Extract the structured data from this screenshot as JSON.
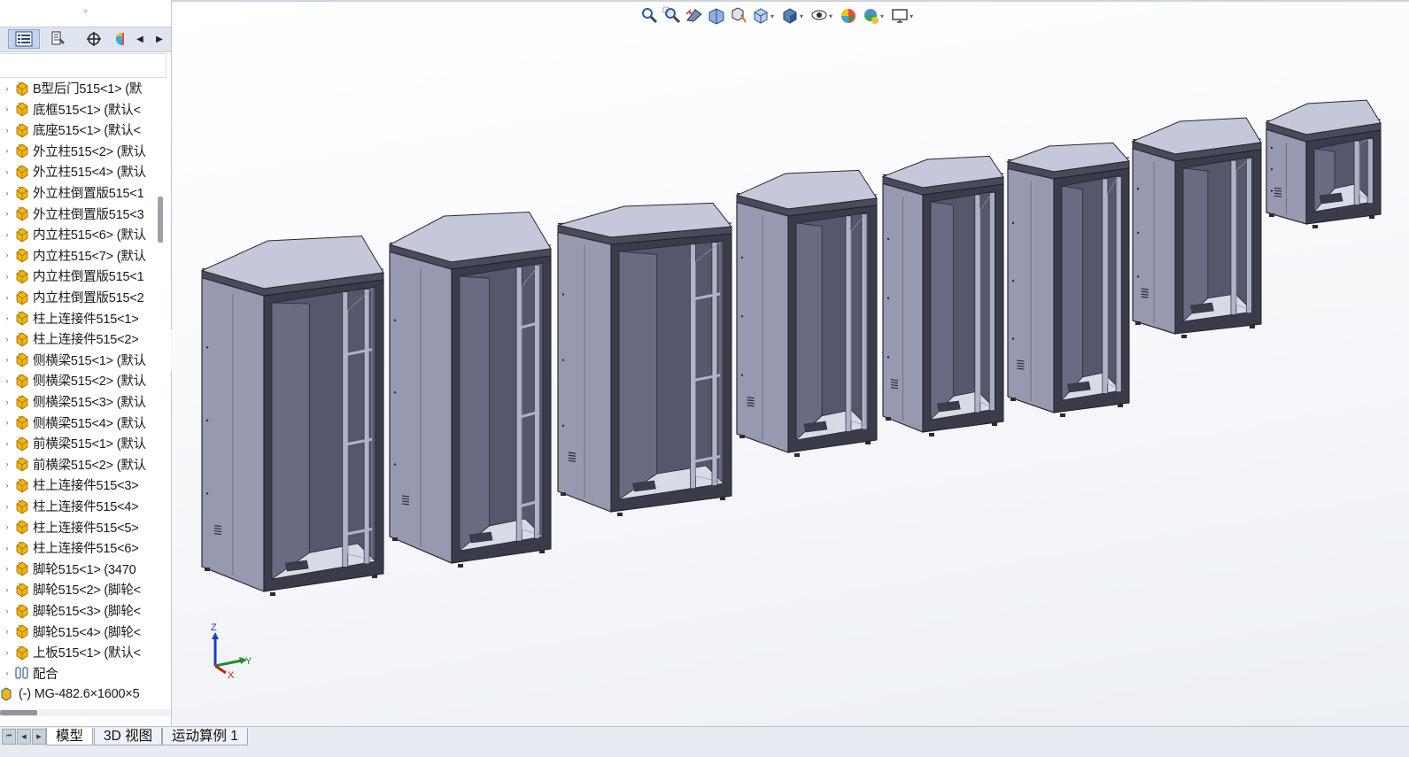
{
  "feature_tree": {
    "items": [
      {
        "label": "B型后门515<1> (默"
      },
      {
        "label": "底框515<1> (默认<"
      },
      {
        "label": "底座515<1> (默认<"
      },
      {
        "label": "外立柱515<2> (默认"
      },
      {
        "label": "外立柱515<4> (默认"
      },
      {
        "label": "外立柱倒置版515<1"
      },
      {
        "label": "外立柱倒置版515<3"
      },
      {
        "label": "内立柱515<6> (默认"
      },
      {
        "label": "内立柱515<7> (默认"
      },
      {
        "label": "内立柱倒置版515<1"
      },
      {
        "label": "内立柱倒置版515<2"
      },
      {
        "label": "柱上连接件515<1>"
      },
      {
        "label": "柱上连接件515<2>"
      },
      {
        "label": "侧横梁515<1> (默认"
      },
      {
        "label": "侧横梁515<2> (默认"
      },
      {
        "label": "侧横梁515<3> (默认"
      },
      {
        "label": "侧横梁515<4> (默认"
      },
      {
        "label": "前横梁515<1> (默认"
      },
      {
        "label": "前横梁515<2> (默认"
      },
      {
        "label": "柱上连接件515<3>"
      },
      {
        "label": "柱上连接件515<4>"
      },
      {
        "label": "柱上连接件515<5>"
      },
      {
        "label": "柱上连接件515<6>"
      },
      {
        "label": "脚轮515<1> (3470"
      },
      {
        "label": "脚轮515<2> (脚轮<"
      },
      {
        "label": "脚轮515<3> (脚轮<"
      },
      {
        "label": "脚轮515<4> (脚轮<"
      },
      {
        "label": "上板515<1> (默认<"
      }
    ],
    "mates_label": "配合",
    "assembly_label": "(-) MG-482.6×1600×5"
  },
  "panel_tabs": [
    {
      "icon": "feature-manager-icon",
      "active": true
    },
    {
      "icon": "property-manager-icon",
      "active": false
    },
    {
      "icon": "configuration-manager-icon",
      "active": false
    },
    {
      "icon": "appearance-icon",
      "active": false
    }
  ],
  "heads_up_toolbar": [
    {
      "icon": "zoom-to-fit-icon"
    },
    {
      "icon": "zoom-to-area-icon"
    },
    {
      "icon": "previous-view-icon"
    },
    {
      "icon": "section-view-icon"
    },
    {
      "icon": "dynamic-annotation-icon"
    },
    {
      "icon": "view-orientation-icon",
      "caret": true
    },
    {
      "icon": "display-style-icon",
      "caret": true
    },
    {
      "icon": "hide-show-items-icon",
      "caret": true
    },
    {
      "icon": "edit-appearance-icon"
    },
    {
      "icon": "apply-scene-icon",
      "caret": true
    },
    {
      "icon": "view-settings-icon",
      "caret": true
    }
  ],
  "triad": {
    "z": "Z",
    "y": "Y",
    "x": "X"
  },
  "bottom_tabs": [
    {
      "label": "模型",
      "active": true
    },
    {
      "label": "3D 视图",
      "active": false
    },
    {
      "label": "运动算例 1",
      "active": false
    }
  ],
  "colors": {
    "panel_face": "#a9acc3",
    "panel_side": "#9799b1",
    "frame_dark": "#3b3c4a",
    "interior": "#56566c",
    "top_face": "#c5c8da",
    "part_icon": "#f2b705"
  }
}
